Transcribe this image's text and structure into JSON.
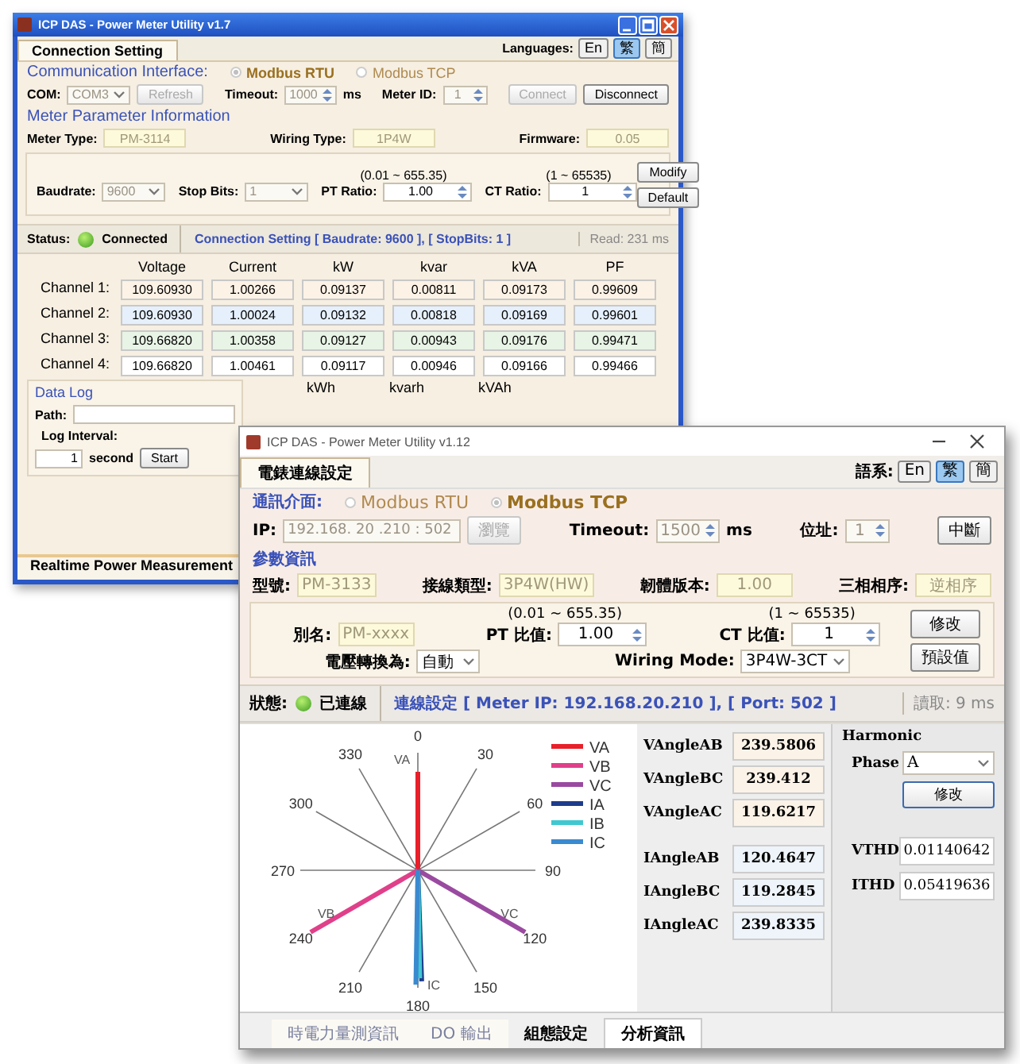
{
  "main_window": {
    "title": "ICP DAS  -  Power Meter Utility v1.7",
    "tab": {
      "label": "Connection Setting",
      "selected": true
    },
    "languages": {
      "label": "Languages:",
      "buttons": [
        {
          "label": "En",
          "selected": false
        },
        {
          "label": "繁",
          "selected": true
        },
        {
          "label": "簡",
          "selected": false
        }
      ]
    },
    "form": [
      {
        "kind": "row",
        "groups": [
          [
            {
              "kind": "heading",
              "text": "Communication Interface:"
            },
            {
              "kind": "radio",
              "label": "Modbus RTU",
              "selected": true
            },
            {
              "kind": "radio",
              "label": "Modbus TCP",
              "selected": false
            }
          ]
        ]
      },
      {
        "kind": "row",
        "groups": [
          [
            {
              "kind": "label",
              "text": "COM:"
            },
            {
              "kind": "select",
              "value": "COM3",
              "disabled": true
            },
            {
              "kind": "button",
              "label": "Refresh",
              "disabled": true
            }
          ],
          [
            {
              "kind": "label",
              "text": "Timeout:"
            },
            {
              "kind": "spin",
              "value": "1000",
              "disabled": true
            },
            {
              "kind": "unit",
              "text": "ms"
            }
          ],
          [
            {
              "kind": "label",
              "text": "Meter ID:"
            },
            {
              "kind": "spin",
              "value": "1",
              "disabled": true
            }
          ],
          [
            {
              "kind": "button",
              "label": "Connect",
              "disabled": true
            },
            {
              "kind": "button",
              "label": "Disconnect",
              "disabled": false
            }
          ]
        ]
      },
      {
        "kind": "row",
        "groups": [
          [
            {
              "kind": "heading",
              "text": "Meter Parameter Information"
            }
          ]
        ]
      },
      {
        "kind": "row",
        "groups": [
          [
            {
              "kind": "label",
              "text": "Meter Type:"
            },
            {
              "kind": "readout",
              "value": "PM-3114"
            }
          ],
          [
            {
              "kind": "label",
              "text": "Wiring Type:"
            },
            {
              "kind": "readout",
              "value": "1P4W"
            }
          ],
          [
            {
              "kind": "label",
              "text": "Firmware:"
            },
            {
              "kind": "readout",
              "value": "0.05"
            }
          ]
        ]
      },
      {
        "kind": "panel",
        "lines": [
          [
            [
              {
                "kind": "label",
                "text": "Baudrate:"
              },
              {
                "kind": "select",
                "value": "9600",
                "disabled": true
              }
            ],
            [
              {
                "kind": "label",
                "text": "Stop Bits:"
              },
              {
                "kind": "select",
                "value": "1",
                "disabled": true
              }
            ],
            [
              {
                "kind": "ratio",
                "range": "(0.01 ~ 655.35)",
                "label": "PT Ratio:",
                "value": "1.00"
              }
            ],
            [
              {
                "kind": "ratio",
                "range": "(1 ~ 65535)",
                "label": "CT Ratio:",
                "value": "1"
              }
            ]
          ]
        ],
        "buttons": [
          {
            "label": "Modify",
            "disabled": false
          },
          {
            "label": "Default",
            "disabled": false
          }
        ]
      }
    ],
    "status": {
      "label": "Status:",
      "connected": true,
      "state": "Connected",
      "info": "Connection Setting [ Baudrate: 9600 ], [ StopBits: 1 ]",
      "read": "Read: 231 ms"
    },
    "table": {
      "columns": [
        "Voltage",
        "Current",
        "kW",
        "kvar",
        "kVA",
        "PF"
      ],
      "rows": [
        {
          "label": "Channel 1:",
          "cells": [
            "109.60930",
            "1.00266",
            "0.09137",
            "0.00811",
            "0.09173",
            "0.99609"
          ]
        },
        {
          "label": "Channel 2:",
          "cells": [
            "109.60930",
            "1.00024",
            "0.09132",
            "0.00818",
            "0.09169",
            "0.99601"
          ]
        },
        {
          "label": "Channel 3:",
          "cells": [
            "109.66820",
            "1.00358",
            "0.09127",
            "0.00943",
            "0.09176",
            "0.99471"
          ]
        },
        {
          "label": "Channel 4:",
          "cells": [
            "109.66820",
            "1.00461",
            "0.09117",
            "0.00946",
            "0.09166",
            "0.99466"
          ]
        }
      ]
    },
    "data_log": {
      "title": "Data Log",
      "path_label": "Path:",
      "interval_label": "Log Interval:",
      "interval": "1",
      "unit": "second",
      "button": "Start",
      "energy_columns": [
        "kWh",
        "kvarh",
        "kVAh"
      ]
    },
    "bottom_tabs": [
      {
        "label": "Realtime Power Measurement",
        "selected": true
      }
    ]
  },
  "overlay_window": {
    "title": "ICP DAS  -  Power Meter Utility v1.12",
    "tab": {
      "label": "電錶連線設定",
      "selected": true
    },
    "languages": {
      "label": "語系:",
      "buttons": [
        {
          "label": "En",
          "selected": false
        },
        {
          "label": "繁",
          "selected": true
        },
        {
          "label": "簡",
          "selected": false
        }
      ]
    },
    "form": [
      {
        "kind": "row",
        "groups": [
          [
            {
              "kind": "heading",
              "text": "通訊介面:"
            },
            {
              "kind": "radio",
              "label": "Modbus RTU",
              "selected": false
            },
            {
              "kind": "radio",
              "label": "Modbus TCP",
              "selected": true
            }
          ]
        ]
      },
      {
        "kind": "row",
        "groups": [
          [
            {
              "kind": "label",
              "text": "IP:"
            },
            {
              "kind": "field",
              "value": "192.168. 20 .210 : 502",
              "disabled": true
            },
            {
              "kind": "button",
              "label": "瀏覽",
              "disabled": true
            }
          ],
          [
            {
              "kind": "label",
              "text": "Timeout:"
            },
            {
              "kind": "spin",
              "value": "1500",
              "disabled": true
            },
            {
              "kind": "unit",
              "text": "ms"
            }
          ],
          [
            {
              "kind": "label",
              "text": "位址:"
            },
            {
              "kind": "spin",
              "value": "1",
              "disabled": true
            }
          ],
          [
            {
              "kind": "button",
              "label": "中斷",
              "disabled": false
            }
          ]
        ]
      },
      {
        "kind": "row",
        "groups": [
          [
            {
              "kind": "heading",
              "text": "參數資訊"
            }
          ]
        ]
      },
      {
        "kind": "row",
        "groups": [
          [
            {
              "kind": "label",
              "text": "型號:"
            },
            {
              "kind": "readout",
              "value": "PM-3133"
            }
          ],
          [
            {
              "kind": "label",
              "text": "接線類型:"
            },
            {
              "kind": "readout",
              "value": "3P4W(HW)"
            }
          ],
          [
            {
              "kind": "label",
              "text": "韌體版本:"
            },
            {
              "kind": "readout",
              "value": "1.00"
            }
          ],
          [
            {
              "kind": "label",
              "text": "三相相序:"
            },
            {
              "kind": "readout",
              "value": "逆相序"
            }
          ]
        ]
      },
      {
        "kind": "panel",
        "lines": [
          [
            [
              {
                "kind": "label",
                "text": "別名:"
              },
              {
                "kind": "readout",
                "value": "PM-xxxx"
              }
            ],
            [
              {
                "kind": "ratio",
                "range": "(0.01 ~ 655.35)",
                "label": "PT 比值:",
                "value": "1.00"
              }
            ],
            [
              {
                "kind": "ratio",
                "range": "(1 ~ 65535)",
                "label": "CT 比值:",
                "value": "1"
              }
            ]
          ],
          [
            [
              {
                "kind": "label",
                "text": "電壓轉換為:"
              },
              {
                "kind": "select",
                "value": "自動",
                "disabled": false
              }
            ],
            [
              {
                "kind": "label",
                "text": "Wiring Mode:"
              },
              {
                "kind": "select",
                "value": "3P4W-3CT",
                "disabled": false
              }
            ]
          ]
        ],
        "buttons": [
          {
            "label": "修改",
            "disabled": false
          },
          {
            "label": "預設值",
            "disabled": false
          }
        ]
      }
    ],
    "status": {
      "label": "狀態:",
      "connected": true,
      "state": "已連線",
      "info": "連線設定 [ Meter IP: 192.168.20.210 ], [ Port: 502 ]",
      "read": "讀取: 9 ms"
    },
    "phasor": {
      "angle_labels": [
        "0",
        "30",
        "60",
        "90",
        "120",
        "150",
        "180",
        "210",
        "240",
        "270",
        "300",
        "330"
      ],
      "legend": [
        {
          "label": "VA",
          "color": "#e8202a"
        },
        {
          "label": "VB",
          "color": "#e0408a"
        },
        {
          "label": "VC",
          "color": "#9a4aa0"
        },
        {
          "label": "IA",
          "color": "#1e3c8c"
        },
        {
          "label": "IB",
          "color": "#40c8d0"
        },
        {
          "label": "IC",
          "color": "#3a8ad0"
        }
      ],
      "vector_labels": [
        "VA",
        "VB",
        "VC",
        "IC"
      ]
    },
    "angles": [
      {
        "kind": "voltage",
        "label": "VAngleAB",
        "value": "239.5806"
      },
      {
        "kind": "voltage",
        "label": "VAngleBC",
        "value": "239.412"
      },
      {
        "kind": "voltage",
        "label": "VAngleAC",
        "value": "119.6217"
      },
      {
        "kind": "current",
        "label": "IAngleAB",
        "value": "120.4647"
      },
      {
        "kind": "current",
        "label": "IAngleBC",
        "value": "119.2845"
      },
      {
        "kind": "current",
        "label": "IAngleAC",
        "value": "239.8335"
      }
    ],
    "harmonic": {
      "title": "Harmonic",
      "phase_label": "Phase",
      "phase": "A",
      "button": "修改",
      "thd": [
        {
          "label": "VTHD",
          "value": "0.01140642"
        },
        {
          "label": "ITHD",
          "value": "0.05419636"
        }
      ]
    },
    "bottom_tabs": [
      {
        "label": "時電力量測資訊",
        "selected": false,
        "disabled": true
      },
      {
        "label": "DO 輸出",
        "selected": false,
        "disabled": true
      },
      {
        "label": "組態設定",
        "selected": false,
        "disabled": false
      },
      {
        "label": "分析資訊",
        "selected": true,
        "disabled": false
      }
    ]
  }
}
